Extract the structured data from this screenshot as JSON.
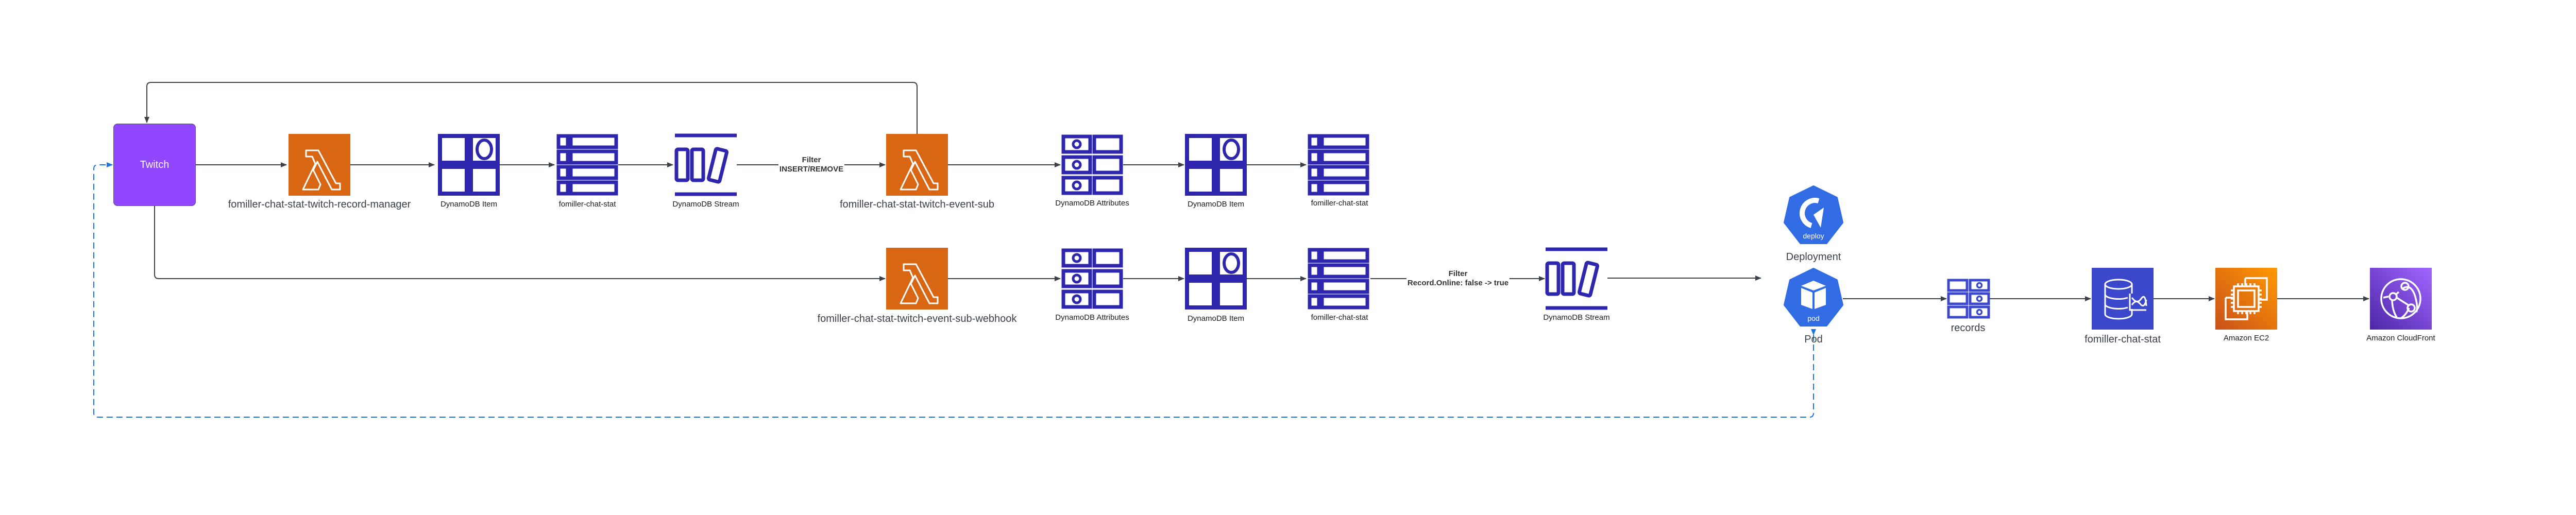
{
  "diagram": {
    "nodes": {
      "twitch": {
        "label": "Twitch",
        "color": "#9146ff"
      },
      "lambda_record_manager": {
        "label": "fomiller-chat-stat-twitch-record-manager",
        "icon": "aws-lambda-icon",
        "color": "#d86613"
      },
      "item_1": {
        "label": "DynamoDB Item",
        "icon": "dynamodb-item-icon"
      },
      "table_1": {
        "label": "fomiller-chat-stat",
        "icon": "dynamodb-table-icon"
      },
      "stream_1": {
        "label": "DynamoDB Stream",
        "icon": "dynamodb-stream-icon"
      },
      "lambda_event_sub": {
        "label": "fomiller-chat-stat-twitch-event-sub",
        "icon": "aws-lambda-icon",
        "color": "#d86613"
      },
      "attributes_1": {
        "label": "DynamoDB Attributes",
        "icon": "dynamodb-attributes-icon"
      },
      "item_2": {
        "label": "DynamoDB Item",
        "icon": "dynamodb-item-icon"
      },
      "table_2": {
        "label": "fomiller-chat-stat",
        "icon": "dynamodb-table-icon"
      },
      "lambda_webhook": {
        "label": "fomiller-chat-stat-twitch-event-sub-webhook",
        "icon": "aws-lambda-icon",
        "color": "#d86613"
      },
      "attributes_2": {
        "label": "DynamoDB Attributes",
        "icon": "dynamodb-attributes-icon"
      },
      "item_3": {
        "label": "DynamoDB Item",
        "icon": "dynamodb-item-icon"
      },
      "table_3": {
        "label": "fomiller-chat-stat",
        "icon": "dynamodb-table-icon"
      },
      "stream_2": {
        "label": "DynamoDB Stream",
        "icon": "dynamodb-stream-icon"
      },
      "deployment": {
        "label": "Deployment",
        "badge": "deploy",
        "icon": "k8s-deployment-icon",
        "color": "#326ce5"
      },
      "pod": {
        "label": "Pod",
        "badge": "pod",
        "icon": "k8s-pod-icon",
        "color": "#326ce5"
      },
      "records": {
        "label": "records",
        "icon": "records-table-icon"
      },
      "database": {
        "label": "fomiller-chat-stat",
        "icon": "database-icon",
        "color": "#3b48cc"
      },
      "ec2": {
        "label": "Amazon EC2",
        "icon": "amazon-ec2-icon",
        "color": "#ed7100"
      },
      "cloudfront": {
        "label": "Amazon CloudFront",
        "icon": "amazon-cloudfront-icon",
        "color": "#8c4fff"
      }
    },
    "edge_labels": {
      "filter_1": {
        "title": "Filter",
        "condition": "INSERT/REMOVE"
      },
      "filter_2": {
        "title": "Filter",
        "condition": "Record.Online: false -> true"
      }
    },
    "colors": {
      "dynamodb_icon": "#2e27ad",
      "edge": "#3c4149",
      "dashed_edge": "#1a73e8"
    }
  }
}
